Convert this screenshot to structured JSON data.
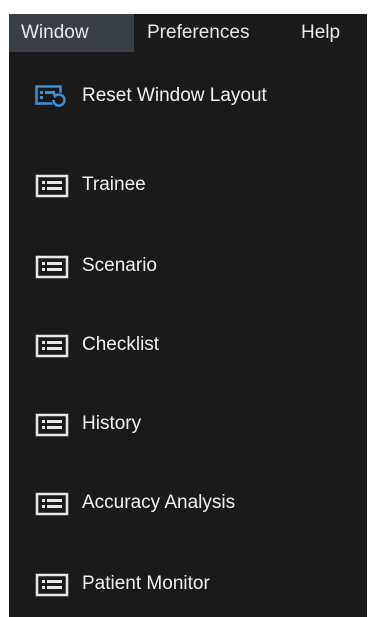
{
  "menubar": {
    "items": [
      {
        "label": "Window",
        "icon": "",
        "active": true
      },
      {
        "label": "Preferences",
        "active": false
      },
      {
        "label": "Help",
        "active": false
      }
    ]
  },
  "window_menu": {
    "items": [
      {
        "label": "Reset Window Layout",
        "icon": "reset-layout-icon"
      },
      {
        "label": "Trainee",
        "icon": "list-window-icon"
      },
      {
        "label": "Scenario",
        "icon": "list-window-icon"
      },
      {
        "label": "Checklist",
        "icon": "list-window-icon"
      },
      {
        "label": "History",
        "icon": "list-window-icon"
      },
      {
        "label": "Accuracy Analysis",
        "icon": "list-window-icon"
      },
      {
        "label": "Patient Monitor",
        "icon": "list-window-icon"
      }
    ]
  },
  "colors": {
    "menu_background": "#1a1a1a",
    "active_menubar_item": "#3a3f47",
    "text": "#f0f0f0",
    "reset_icon_blue": "#3a8fd6",
    "list_icon": "#e8e8e8"
  }
}
